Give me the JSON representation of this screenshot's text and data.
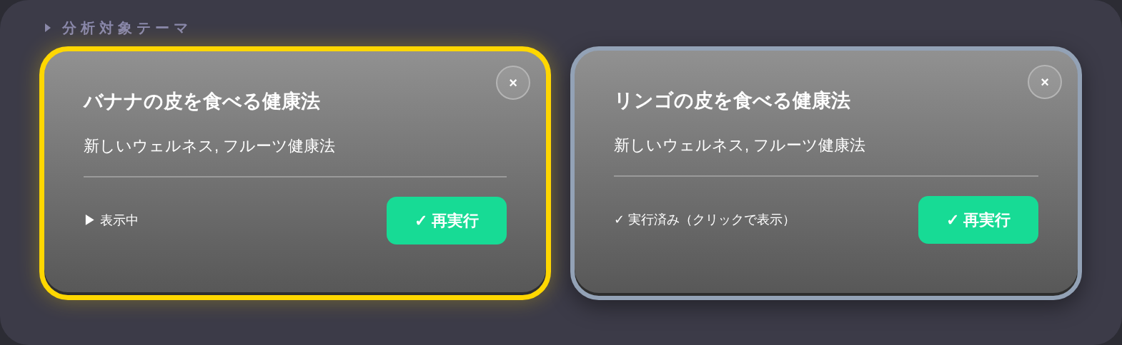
{
  "section": {
    "title": "分析対象テーマ",
    "expanded": false
  },
  "cards": [
    {
      "title": "バナナの皮を食べる健康法",
      "subtitle": "新しいウェルネス, フルーツ健康法",
      "status": "▶ 表示中",
      "button": "✓ 再実行",
      "close": "×",
      "selected": true
    },
    {
      "title": "リンゴの皮を食べる健康法",
      "subtitle": "新しいウェルネス, フルーツ健康法",
      "status": "✓ 実行済み（クリックで表示）",
      "button": "✓ 再実行",
      "close": "×",
      "selected": false
    }
  ]
}
